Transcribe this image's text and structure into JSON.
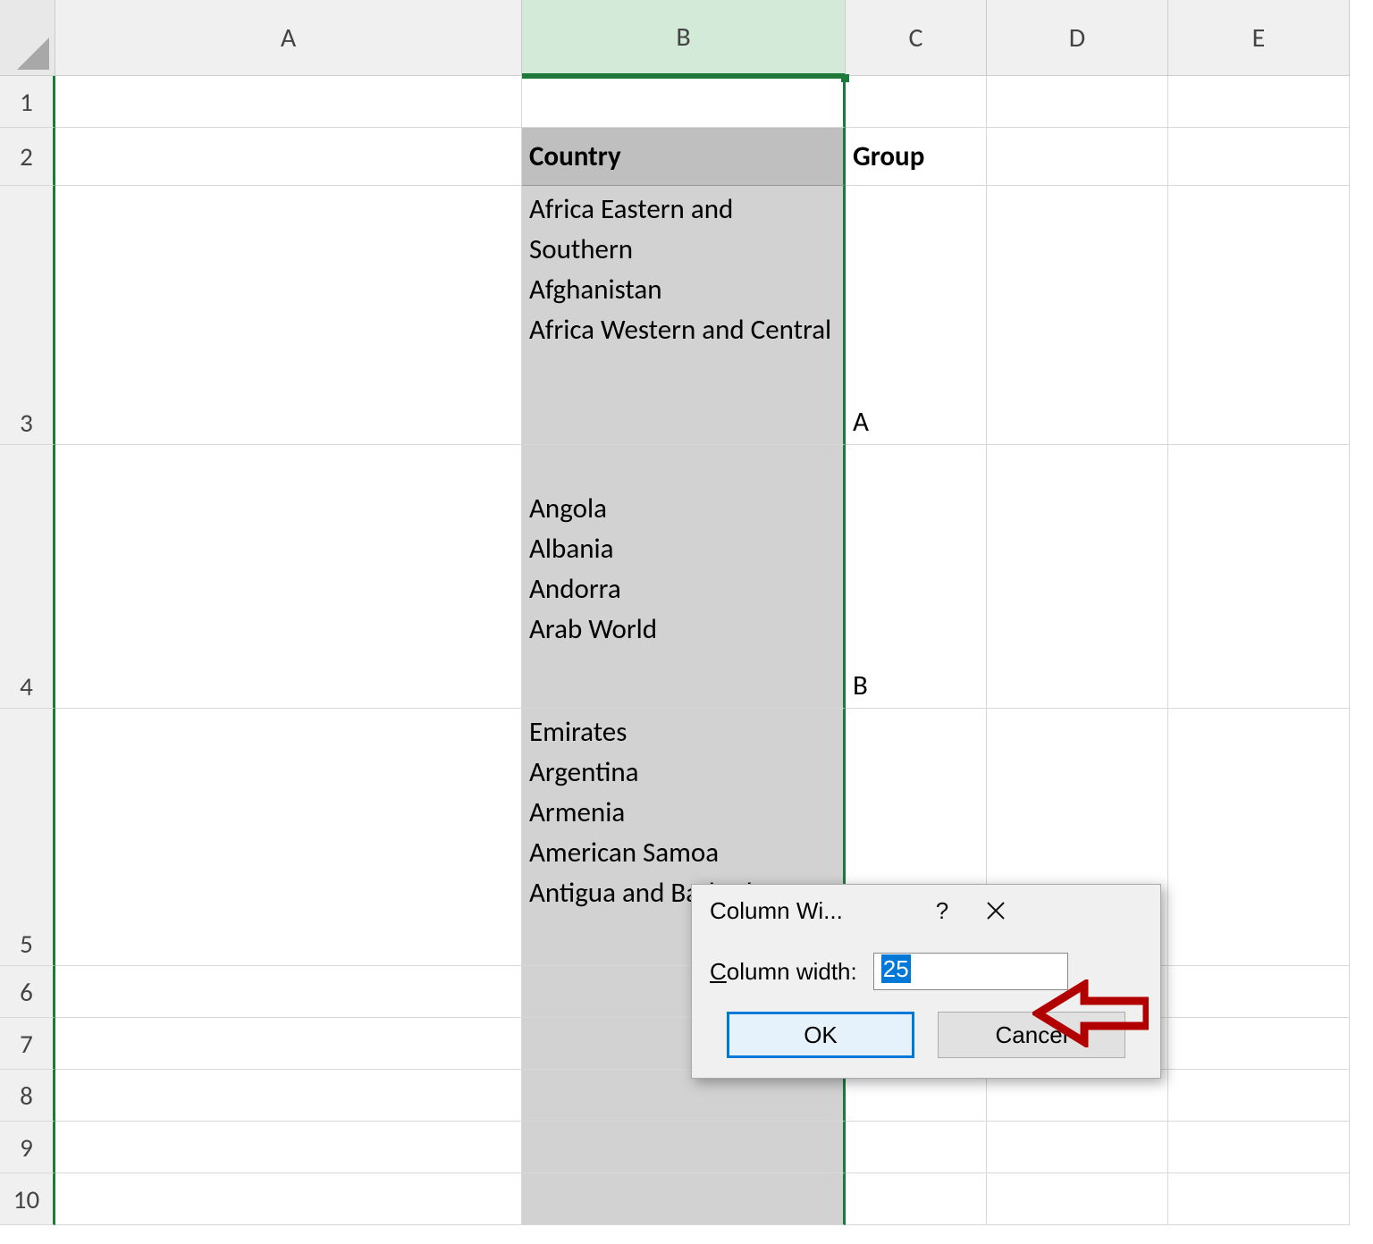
{
  "columns": [
    "A",
    "B",
    "C",
    "D",
    "E"
  ],
  "rows": [
    "1",
    "2",
    "3",
    "4",
    "5",
    "6",
    "7",
    "8",
    "9",
    "10"
  ],
  "cells": {
    "b2": "Country",
    "c2": "Group",
    "b3": "Africa Eastern and Southern\nAfghanistan\nAfrica Western and Central",
    "c3": "A",
    "b4": "\nAngola\nAlbania\nAndorra\nArab World",
    "c4": "B",
    "b5": "Emirates\nArgentina\nArmenia\nAmerican Samoa\nAntigua and Barbuda"
  },
  "dialog": {
    "title": "Column Wi...",
    "label_prefix": "C",
    "label_rest": "olumn width:",
    "value": "25",
    "ok": "OK",
    "cancel": "Cancel"
  }
}
